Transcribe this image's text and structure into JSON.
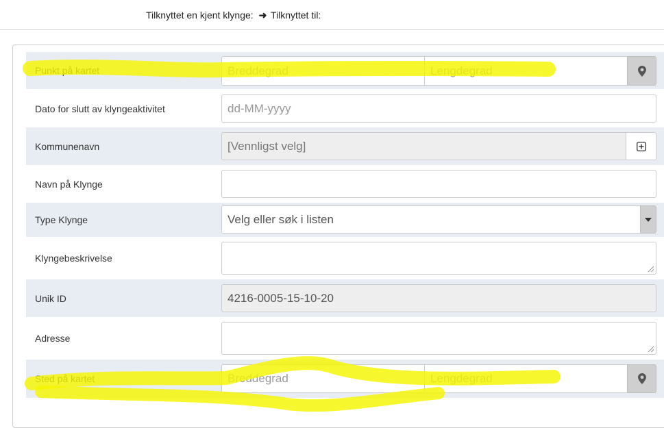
{
  "header": {
    "connected_known_cluster": "Tilknyttet en kjent klynge:",
    "connected_to": "Tilknyttet til:"
  },
  "form": {
    "point_on_map": {
      "label": "Punkt på kartet",
      "latitude_placeholder": "Breddegrad",
      "longitude_placeholder": "Lengdegrad",
      "icon": "map-marker-icon"
    },
    "end_date": {
      "label": "Dato for slutt av klyngeaktivitet",
      "placeholder": "dd-MM-yyyy"
    },
    "municipality": {
      "label": "Kommunenavn",
      "value": "[Vennligst velg]",
      "icon": "plus-square-icon"
    },
    "cluster_name": {
      "label": "Navn på Klynge",
      "value": ""
    },
    "cluster_type": {
      "label": "Type Klynge",
      "placeholder": "Velg eller søk i listen",
      "icon": "caret-down-icon"
    },
    "cluster_description": {
      "label": "Klyngebeskrivelse",
      "value": ""
    },
    "unique_id": {
      "label": "Unik ID",
      "value": "4216-0005-15-10-20"
    },
    "address": {
      "label": "Adresse",
      "value": ""
    },
    "place_on_map": {
      "label": "Sted på kartet",
      "latitude_placeholder": "Breddegrad",
      "longitude_placeholder": "Lengdegrad",
      "icon": "map-marker-icon"
    }
  },
  "colors": {
    "row_shade": "#e8edf4",
    "highlighter": "#f5f500"
  }
}
